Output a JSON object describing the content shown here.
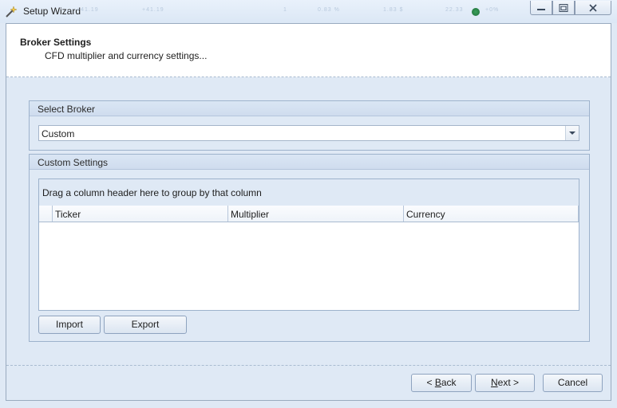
{
  "window": {
    "title": "Setup Wizard",
    "background_blur": [
      "+41.19",
      "1",
      "0.83 %",
      "1.83 $",
      "22.33",
      "+0%"
    ],
    "controls": {
      "minimize": "minimize-icon",
      "restore": "restore-icon",
      "close": "close-icon"
    }
  },
  "header": {
    "title": "Broker Settings",
    "subtitle": "CFD multiplier and currency settings..."
  },
  "select_broker": {
    "group_title": "Select Broker",
    "value": "Custom"
  },
  "custom_settings": {
    "group_title": "Custom Settings",
    "group_panel_hint": "Drag a column header here to group by that column",
    "columns": [
      "Ticker",
      "Multiplier",
      "Currency"
    ],
    "rows": [],
    "import_label": "Import",
    "export_label": "Export"
  },
  "footer": {
    "back_prefix": "< ",
    "back_accel": "B",
    "back_rest": "ack",
    "next_accel": "N",
    "next_rest": "ext >",
    "cancel_label": "Cancel"
  },
  "colors": {
    "background": "#dfe9f5",
    "group_border": "#9db2cc",
    "header_bg": "#ffffff"
  }
}
